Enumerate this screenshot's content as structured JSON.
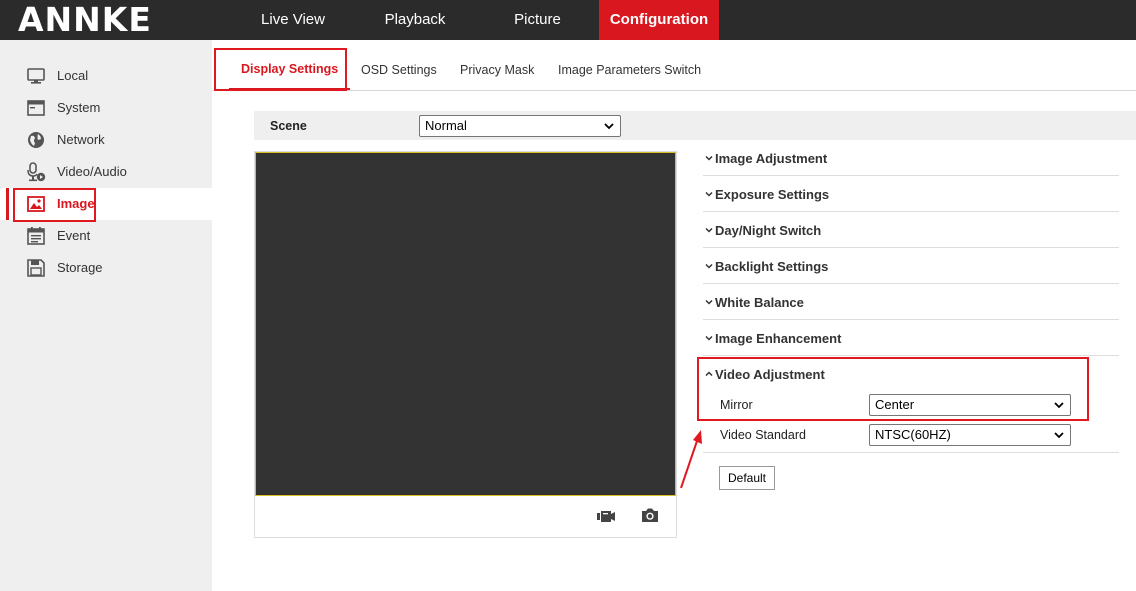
{
  "brand": {
    "logo_text": "ANNKE",
    "accent_color": "#d9171f"
  },
  "topnav": [
    {
      "label": "Live View",
      "active": false
    },
    {
      "label": "Playback",
      "active": false
    },
    {
      "label": "Picture",
      "active": false
    },
    {
      "label": "Configuration",
      "active": true
    }
  ],
  "sidebar": {
    "items": [
      {
        "label": "Local",
        "icon": "monitor-icon"
      },
      {
        "label": "System",
        "icon": "system-window-icon"
      },
      {
        "label": "Network",
        "icon": "globe-icon"
      },
      {
        "label": "Video/Audio",
        "icon": "microphone-icon"
      },
      {
        "label": "Image",
        "icon": "image-icon",
        "active": true
      },
      {
        "label": "Event",
        "icon": "calendar-icon"
      },
      {
        "label": "Storage",
        "icon": "floppy-disk-icon"
      }
    ]
  },
  "tabs": [
    {
      "label": "Display Settings",
      "active": true
    },
    {
      "label": "OSD Settings"
    },
    {
      "label": "Privacy Mask"
    },
    {
      "label": "Image Parameters Switch"
    }
  ],
  "scene": {
    "label": "Scene",
    "value": "Normal"
  },
  "preview": {
    "record_icon": "video-record-icon",
    "capture_icon": "camera-capture-icon"
  },
  "sections": [
    {
      "label": "Image Adjustment",
      "expanded": false
    },
    {
      "label": "Exposure Settings",
      "expanded": false
    },
    {
      "label": "Day/Night Switch",
      "expanded": false
    },
    {
      "label": "Backlight Settings",
      "expanded": false
    },
    {
      "label": "White Balance",
      "expanded": false
    },
    {
      "label": "Image Enhancement",
      "expanded": false
    },
    {
      "label": "Video Adjustment",
      "expanded": true
    }
  ],
  "video_adjustment": {
    "mirror": {
      "label": "Mirror",
      "value": "Center"
    },
    "video_standard": {
      "label": "Video Standard",
      "value": "NTSC(60HZ)"
    }
  },
  "default_button": "Default"
}
